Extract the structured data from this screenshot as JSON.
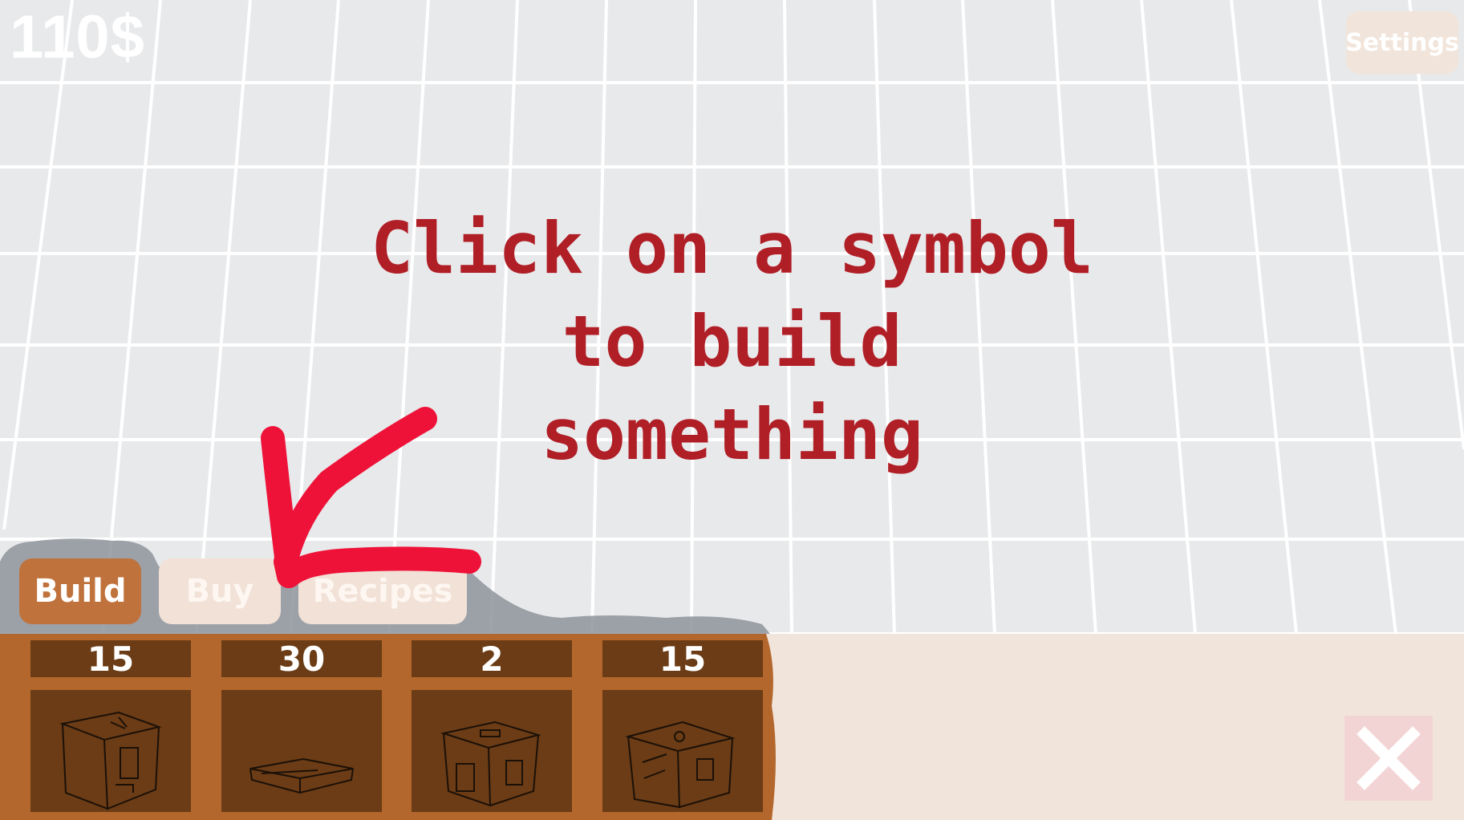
{
  "hud": {
    "money": "110$",
    "settings_label": "Settings"
  },
  "hint": {
    "text": "Click on a symbol\nto build\nsomething"
  },
  "tabs": [
    {
      "label": "Build",
      "active": true
    },
    {
      "label": "Buy",
      "active": false
    },
    {
      "label": "Recipes",
      "active": false
    }
  ],
  "build_items": [
    {
      "price": "15",
      "icon": "small-house-icon"
    },
    {
      "price": "30",
      "icon": "platform-icon"
    },
    {
      "price": "2",
      "icon": "crate-house-icon"
    },
    {
      "price": "15",
      "icon": "decorated-house-icon"
    }
  ],
  "colors": {
    "accent": "#c0723c",
    "panel_dark": "#6b3c15",
    "hint_text": "#b01e26",
    "arrow": "#ee1238",
    "panel_light": "#f1e4da"
  },
  "close_icon": "close-icon"
}
